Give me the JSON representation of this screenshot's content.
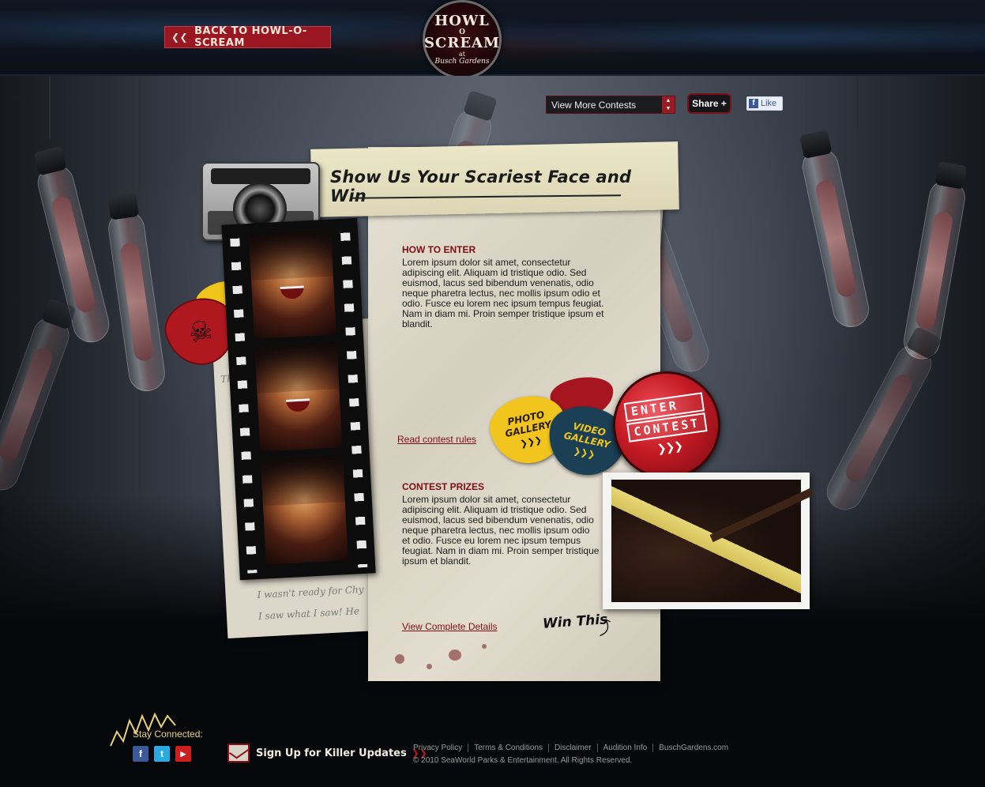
{
  "header": {
    "back_label": "BACK TO HOWL-O-SCREAM",
    "logo": {
      "line1": "HOWL",
      "line2": "O",
      "line3": "SCREAM",
      "line4": "at",
      "line5": "Busch Gardens"
    }
  },
  "controls": {
    "contest_select": "View More Contests",
    "share_label": "Share +",
    "like_label": "Like"
  },
  "contest": {
    "title": "Show Us Your Scariest Face and Win",
    "how_to_enter": {
      "heading": "HOW TO ENTER",
      "body": "Lorem ipsum dolor sit amet, consectetur adipiscing elit. Aliquam id tristique odio. Sed euismod, lacus sed bibendum venenatis, odio neque pharetra lectus, nec mollis ipsum odio et odio. Fusce eu lorem nec ipsum tempus feugiat. Nam in diam mi. Proin semper tristique ipsum et blandit."
    },
    "rules_link": "Read contest rules",
    "prizes": {
      "heading": "CONTEST PRIZES",
      "body": "Lorem ipsum dolor sit amet, consectetur adipiscing elit. Aliquam id tristique odio. Sed euismod, lacus sed bibendum venenatis, odio neque pharetra lectus, nec mollis ipsum odio et odio. Fusce eu lorem nec ipsum tempus feugiat. Nam in diam mi. Proin semper tristique ipsum et blandit."
    },
    "details_link": "View Complete Details",
    "win_this": "Win This",
    "photo_gallery": [
      "PHOTO",
      "GALLERY"
    ],
    "video_gallery": [
      "VIDEO",
      "GALLERY"
    ],
    "enter_contest": [
      "ENTER",
      "CONTEST"
    ],
    "scribbles": [
      "The",
      "I wasn't ready for Chy",
      "I saw what I saw! He"
    ]
  },
  "footer": {
    "stay_connected": "Stay Connected:",
    "social": [
      {
        "name": "facebook-icon",
        "glyph": "f",
        "color": "#3b5998"
      },
      {
        "name": "twitter-icon",
        "glyph": "t",
        "color": "#2aa9e0"
      },
      {
        "name": "youtube-icon",
        "glyph": "▶",
        "color": "#cc1f1f"
      }
    ],
    "signup_label": "Sign Up for Killer Updates",
    "links": [
      "Privacy Policy",
      "Terms & Conditions",
      "Disclaimer",
      "Audition Info",
      "BuschGardens.com"
    ],
    "copyright": "© 2010 SeaWorld Parks & Entertainment. All Rights Reserved."
  },
  "colors": {
    "accent_red": "#9a1620",
    "link_red": "#7d0e15",
    "pick_yellow": "#f1c51d",
    "pick_blue": "#1b3f55"
  }
}
